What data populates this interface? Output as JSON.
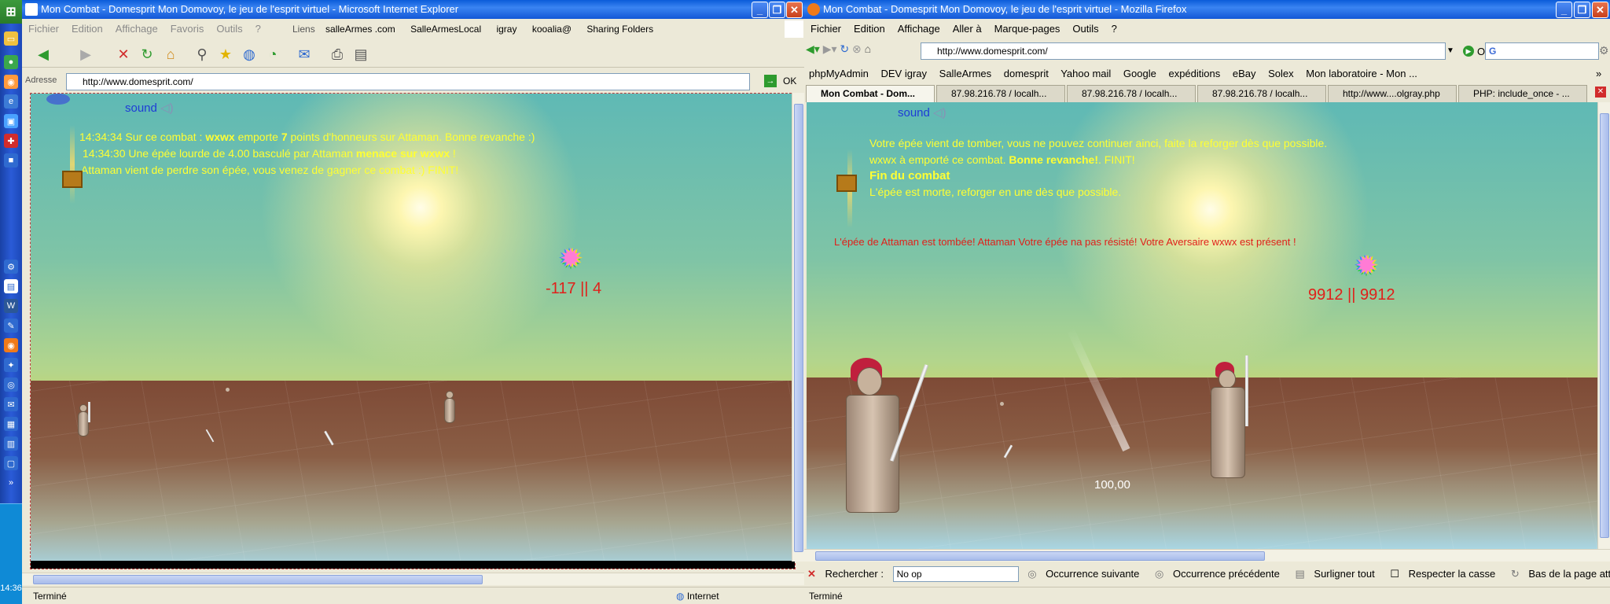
{
  "taskbar": {
    "clock": "14:36",
    "start": "⊞"
  },
  "ie": {
    "title": "Mon Combat - Domesprit Mon Domovoy, le jeu de l'esprit virtuel - Microsoft Internet Explorer",
    "menu": [
      "Fichier",
      "Edition",
      "Affichage",
      "Favoris",
      "Outils",
      "?"
    ],
    "links_label": "Liens",
    "links": [
      "salleArmes .com",
      "SalleArmesLocal",
      "igray",
      "kooalia@",
      "Sharing Folders"
    ],
    "address_label": "Adresse",
    "address": "http://www.domesprit.com/",
    "go": "OK",
    "status": "Terminé",
    "zone": "Internet",
    "page": {
      "sound": "sound",
      "msg1_pre": "14:34:34 Sur ce combat : ",
      "msg1_name": "wxwx",
      "msg1_mid": " emporte ",
      "msg1_points": "7",
      "msg1_post": " points d'honneurs sur Attaman. Bonne revanche :)",
      "msg2_pre": "14:34:30 Une épée lourde de 4.00  basculé par Attaman ",
      "msg2_bold": "menace sur wxwx",
      "msg2_post": " !",
      "msg3": "Attaman vient de perdre son épée, vous venez de gagner ce combat :) FINIT!",
      "score": "-117 || 4"
    }
  },
  "ff": {
    "title": "Mon Combat - Domesprit Mon Domovoy, le jeu de l'esprit virtuel - Mozilla Firefox",
    "menu": [
      "Fichier",
      "Edition",
      "Affichage",
      "Aller à",
      "Marque-pages",
      "Outils",
      "?"
    ],
    "address": "http://www.domesprit.com/",
    "go": "OK",
    "search_placeholder": "G",
    "bookmarks": [
      "phpMyAdmin",
      "DEV igray",
      "SalleArmes",
      "domesprit",
      "Yahoo mail",
      "Google",
      "expéditions",
      "eBay",
      "Solex",
      "Mon laboratoire - Mon ..."
    ],
    "tabs": [
      "Mon Combat - Dom...",
      "87.98.216.78 / localh...",
      "87.98.216.78 / localh...",
      "87.98.216.78 / localh...",
      "http://www....olgray.php",
      "PHP: include_once - ..."
    ],
    "page": {
      "sound": "sound",
      "line1": "Votre épée vient de tomber, vous ne pouvez continuer ainci, faite la reforger dès que possible.",
      "line2_pre": "wxwx à emporté ce combat. ",
      "line2_bold": "Bonne revanche!",
      "line2_post": ". FINIT!",
      "line3": "Fin du combat",
      "line4": "L'épée est morte, reforger en une dès que possible.",
      "red": "L'épée de Attaman est tombée! Attaman Votre épée na pas résisté!  Votre Aversaire wxwx est présent !",
      "score": "9912 || 9912",
      "value": "100,00"
    },
    "find": {
      "label": "Rechercher :",
      "value": "No op",
      "next": "Occurrence suivante",
      "prev": "Occurrence précédente",
      "highlight": "Surligner tout",
      "case": "Respecter la casse",
      "notice": "Bas de la page atteint, pours"
    },
    "status": "Terminé"
  }
}
